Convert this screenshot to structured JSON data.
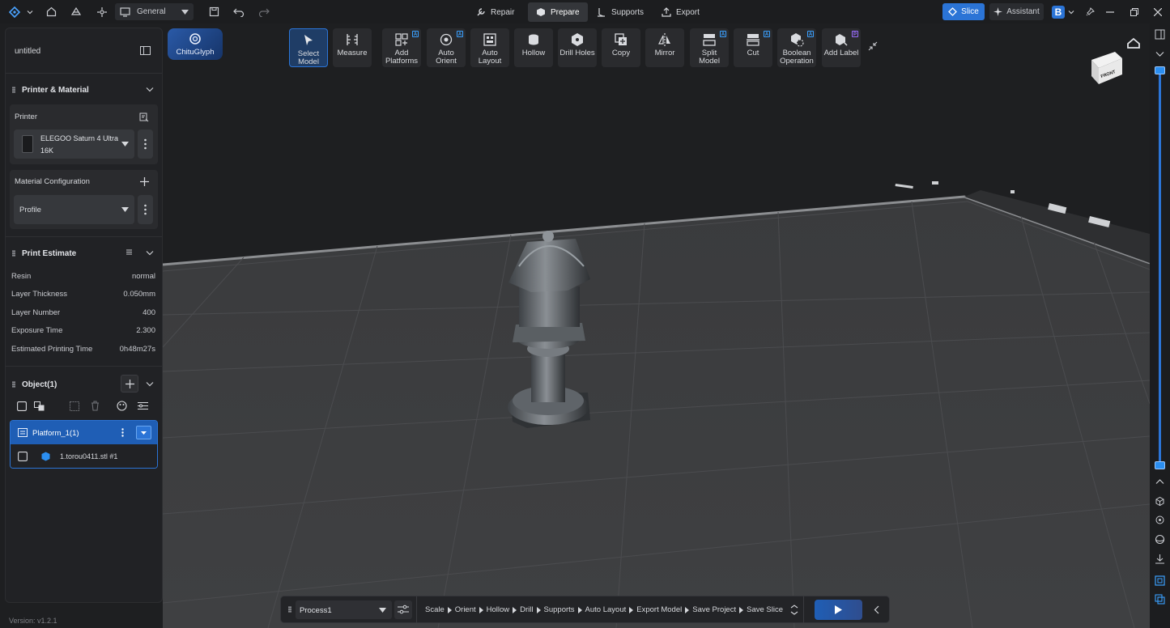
{
  "topbar": {
    "workspace": "General",
    "modes": [
      {
        "label": "Repair",
        "icon": "wrench-icon"
      },
      {
        "label": "Prepare",
        "icon": "cube-icon"
      },
      {
        "label": "Supports",
        "icon": "support-icon"
      },
      {
        "label": "Export",
        "icon": "export-icon"
      }
    ],
    "slice_label": "Slice",
    "assistant_label": "Assistant",
    "accent_color": "#2b74d6"
  },
  "chitu_label": "ChituGlyph",
  "sidebar": {
    "file_name": "untitled",
    "printer_material_title": "Printer & Material",
    "printer_label": "Printer",
    "printer_name_line1": "ELEGOO Saturn 4 Ultra",
    "printer_name_line2": "16K",
    "material_config_label": "Material Configuration",
    "profile_value": "Profile",
    "estimate_title": "Print Estimate",
    "estimate_rows": [
      {
        "label": "Resin",
        "value": "normal"
      },
      {
        "label": "Layer Thickness",
        "value": "0.050mm"
      },
      {
        "label": "Layer Number",
        "value": "400"
      },
      {
        "label": "Exposure Time",
        "value": "2.300"
      },
      {
        "label": "Estimated Printing Time",
        "value": "0h48m27s"
      }
    ],
    "object_title": "Object(1)",
    "platform_label": "Platform_1(1)",
    "model_label": "1.torou0411.stl #1",
    "version": "Version: v1.2.1"
  },
  "toolbar": [
    {
      "label1": "Select",
      "label2": "Model",
      "icon": "cursor-icon"
    },
    {
      "label1": "Measure",
      "label2": "",
      "icon": "ruler-icon"
    },
    {
      "label1": "Add",
      "label2": "Platforms",
      "icon": "grid-plus-icon",
      "badge": "A"
    },
    {
      "label1": "Auto",
      "label2": "Orient",
      "icon": "orient-icon",
      "badge": "A"
    },
    {
      "label1": "Auto",
      "label2": "Layout",
      "icon": "layout-icon"
    },
    {
      "label1": "Hollow",
      "label2": "",
      "icon": "hollow-icon"
    },
    {
      "label1": "Drill Holes",
      "label2": "",
      "icon": "drill-icon"
    },
    {
      "label1": "Copy",
      "label2": "",
      "icon": "copy-icon"
    },
    {
      "label1": "Mirror",
      "label2": "",
      "icon": "mirror-icon"
    },
    {
      "label1": "Split",
      "label2": "Model",
      "icon": "split-icon",
      "badge": "A"
    },
    {
      "label1": "Cut",
      "label2": "",
      "icon": "cut-icon",
      "badge": "A"
    },
    {
      "label1": "Boolean",
      "label2": "Operation",
      "icon": "boolean-icon",
      "badge": "A"
    },
    {
      "label1": "Add Label",
      "label2": "",
      "icon": "label-icon",
      "badge": "P"
    }
  ],
  "view_cube_label": "FRONT",
  "bottombar": {
    "process": "Process1",
    "steps": [
      "Scale",
      "Orient",
      "Hollow",
      "Drill",
      "Supports",
      "Auto Layout",
      "Export Model",
      "Save Project",
      "Save Slice"
    ]
  }
}
